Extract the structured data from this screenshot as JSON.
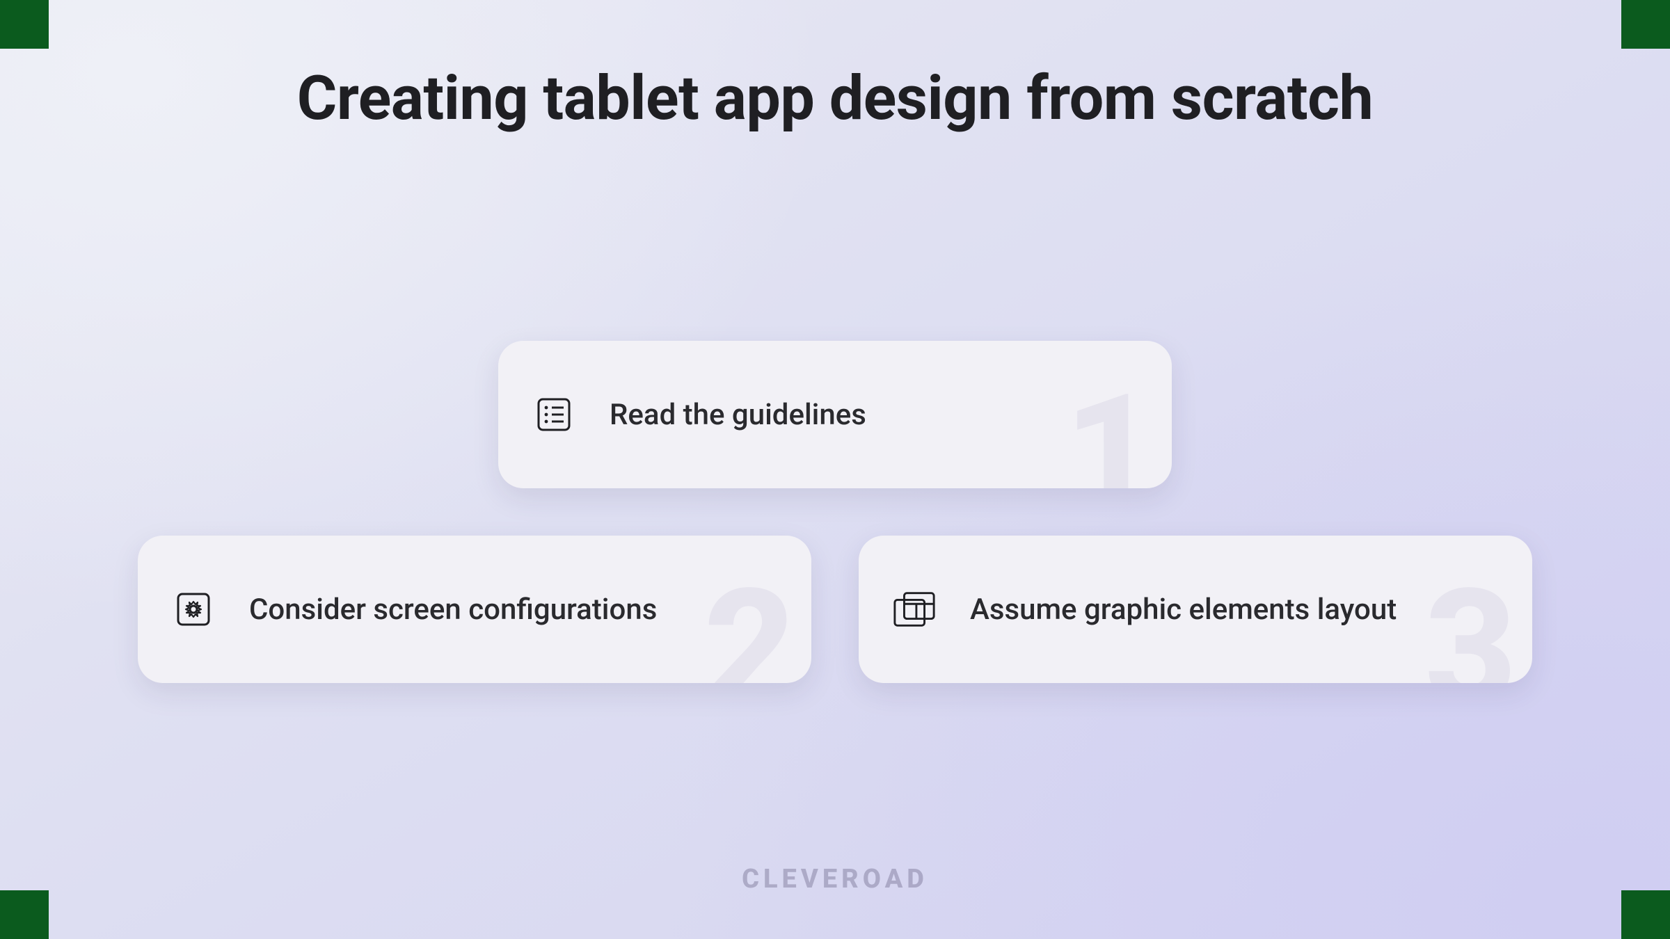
{
  "title": "Creating tablet app design from scratch",
  "brand": "CLEVEROAD",
  "cards": [
    {
      "num": "1",
      "label": "Read the guidelines",
      "icon": "checklist-icon"
    },
    {
      "num": "2",
      "label": "Consider screen configurations",
      "icon": "settings-panel-icon"
    },
    {
      "num": "3",
      "label": "Assume graphic elements layout",
      "icon": "layout-grid-icon"
    }
  ]
}
